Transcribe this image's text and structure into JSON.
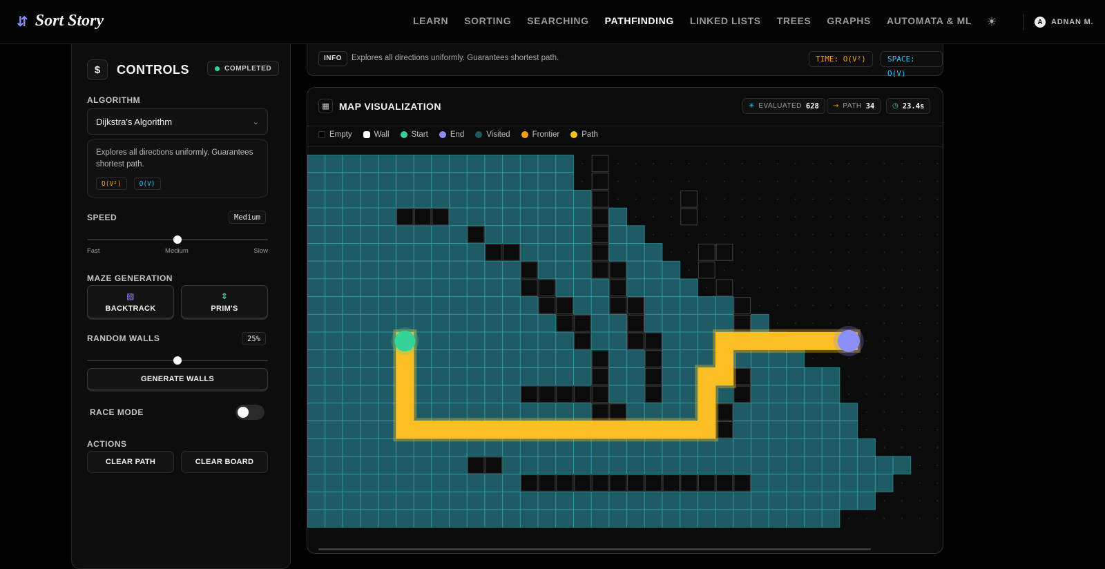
{
  "header": {
    "brand": "Sort Story",
    "brand_icon": "sort-arrows-icon",
    "nav": [
      "LEARN",
      "SORTING",
      "SEARCHING",
      "PATHFINDING",
      "LINKED LISTS",
      "TREES",
      "GRAPHS",
      "AUTOMATA & ML"
    ],
    "active_nav": "PATHFINDING",
    "theme_icon": "sun-icon",
    "user_initial": "A",
    "user_name": "ADNAN M."
  },
  "controls": {
    "title": "CONTROLS",
    "status": "COMPLETED",
    "algorithm_label": "ALGORITHM",
    "algorithm_value": "Dijkstra's Algorithm",
    "description": "Explores all directions uniformly. Guarantees shortest path.",
    "time_complexity": "O(V²)",
    "space_complexity": "O(V)",
    "speed_label": "SPEED",
    "speed_value": "Medium",
    "speed_level": 0.5,
    "speed_ticks": [
      "Fast",
      "Medium",
      "Slow"
    ],
    "maze_label": "MAZE GENERATION",
    "maze_buttons": [
      "BACKTRACK",
      "PRIM'S"
    ],
    "random_walls_label": "RANDOM WALLS",
    "random_walls_value": "25%",
    "random_walls_level": 0.5,
    "generate_label": "GENERATE WALLS",
    "race_label": "RACE MODE",
    "race_enabled": false,
    "actions_label": "ACTIONS",
    "clear_path_label": "CLEAR PATH",
    "clear_board_label": "CLEAR BOARD"
  },
  "info": {
    "badge": "INFO",
    "text": "Explores all directions uniformly. Guarantees shortest path.",
    "time": "TIME: O(V²)",
    "space": "SPACE: O(V)"
  },
  "map": {
    "title": "MAP VISUALIZATION",
    "stats": {
      "evaluated_label": "EVALUATED",
      "evaluated_value": "628",
      "path_label": "PATH",
      "path_value": "34",
      "time_value": "23.4s"
    },
    "legend": [
      "Empty",
      "Wall",
      "Start",
      "End",
      "Visited",
      "Frontier",
      "Path"
    ],
    "colors": {
      "start": "#34d399",
      "end": "#8b8ff8",
      "visited": "#1e5b64",
      "visited_line": "#3fc8dc",
      "frontier": "#f59e0b",
      "path": "#fbbf24",
      "wall": "#0b0b0b"
    },
    "grid": {
      "cols": 35,
      "rows": 21,
      "start": [
        5,
        10
      ],
      "end": [
        30,
        10
      ],
      "walls": [
        [
          16,
          0
        ],
        [
          16,
          1
        ],
        [
          16,
          2
        ],
        [
          16,
          3
        ],
        [
          16,
          4
        ],
        [
          16,
          5
        ],
        [
          16,
          6
        ],
        [
          5,
          3
        ],
        [
          6,
          3
        ],
        [
          7,
          3
        ],
        [
          9,
          4
        ],
        [
          10,
          5
        ],
        [
          11,
          5
        ],
        [
          12,
          6
        ],
        [
          12,
          7
        ],
        [
          13,
          7
        ],
        [
          13,
          8
        ],
        [
          14,
          8
        ],
        [
          14,
          9
        ],
        [
          15,
          9
        ],
        [
          15,
          10
        ],
        [
          17,
          6
        ],
        [
          17,
          7
        ],
        [
          18,
          8
        ],
        [
          17,
          8
        ],
        [
          18,
          9
        ],
        [
          18,
          10
        ],
        [
          19,
          10
        ],
        [
          19,
          11
        ],
        [
          19,
          12
        ],
        [
          19,
          13
        ],
        [
          16,
          11
        ],
        [
          16,
          12
        ],
        [
          16,
          13
        ],
        [
          12,
          13
        ],
        [
          13,
          13
        ],
        [
          14,
          13
        ],
        [
          15,
          13
        ],
        [
          16,
          14
        ],
        [
          17,
          14
        ],
        [
          21,
          2
        ],
        [
          21,
          3
        ],
        [
          22,
          5
        ],
        [
          22,
          6
        ],
        [
          23,
          5
        ],
        [
          23,
          7
        ],
        [
          24,
          8
        ],
        [
          24,
          9
        ],
        [
          24,
          12
        ],
        [
          24,
          13
        ],
        [
          23,
          14
        ],
        [
          23,
          15
        ],
        [
          9,
          17
        ],
        [
          10,
          17
        ],
        [
          12,
          18
        ],
        [
          13,
          18
        ],
        [
          14,
          18
        ],
        [
          15,
          18
        ],
        [
          16,
          18
        ],
        [
          17,
          18
        ],
        [
          18,
          18
        ],
        [
          19,
          18
        ],
        [
          20,
          18
        ],
        [
          21,
          18
        ],
        [
          22,
          18
        ],
        [
          23,
          18
        ],
        [
          24,
          18
        ]
      ],
      "visited_rows": [
        15,
        15,
        17,
        18,
        19,
        20,
        21,
        22,
        24,
        26,
        27,
        28,
        30,
        30,
        31,
        31,
        32,
        34,
        33,
        32,
        30
      ],
      "path": [
        [
          5,
          10
        ],
        [
          5,
          11
        ],
        [
          5,
          12
        ],
        [
          5,
          13
        ],
        [
          5,
          14
        ],
        [
          5,
          15
        ],
        [
          6,
          15
        ],
        [
          7,
          15
        ],
        [
          8,
          15
        ],
        [
          9,
          15
        ],
        [
          10,
          15
        ],
        [
          11,
          15
        ],
        [
          12,
          15
        ],
        [
          13,
          15
        ],
        [
          14,
          15
        ],
        [
          15,
          15
        ],
        [
          16,
          15
        ],
        [
          17,
          15
        ],
        [
          18,
          15
        ],
        [
          19,
          15
        ],
        [
          20,
          15
        ],
        [
          21,
          15
        ],
        [
          22,
          15
        ],
        [
          22,
          14
        ],
        [
          22,
          13
        ],
        [
          22,
          12
        ],
        [
          23,
          12
        ],
        [
          23,
          11
        ],
        [
          23,
          10
        ],
        [
          24,
          10
        ],
        [
          25,
          10
        ],
        [
          26,
          10
        ],
        [
          27,
          10
        ],
        [
          28,
          10
        ],
        [
          29,
          10
        ],
        [
          30,
          10
        ]
      ]
    }
  }
}
